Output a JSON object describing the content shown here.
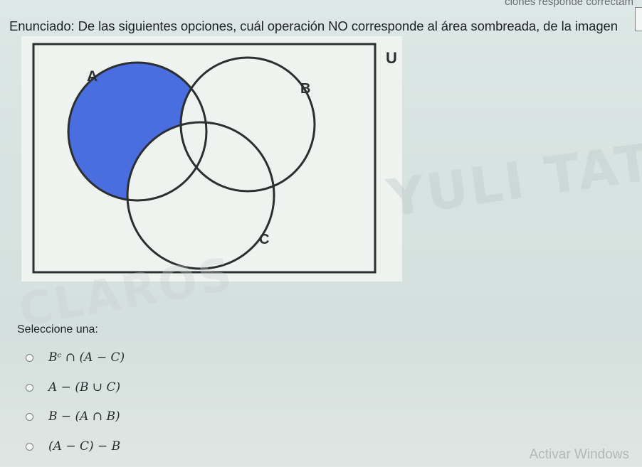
{
  "header": {
    "fragment": "ciones responde correctam"
  },
  "question": {
    "statement": "Enunciado: De las siguientes opciones, cuál operación NO corresponde al área sombreada, de la imagen"
  },
  "venn": {
    "universe_label": "U",
    "set_labels": {
      "a": "A",
      "b": "B",
      "c": "C"
    },
    "shaded_region": "A − (B ∪ C)",
    "colors": {
      "shade": "#4a6ee0",
      "outline": "#2c2f31",
      "background": "#eff3f0"
    }
  },
  "answers": {
    "prompt": "Seleccione una:",
    "options": [
      {
        "label": "Bᶜ ∩ (A − C)"
      },
      {
        "label": "A − (B ∪ C)"
      },
      {
        "label": "B − (A ∩ B)"
      },
      {
        "label": "(A − C) − B"
      }
    ]
  },
  "watermark": {
    "line1": "YULI TATIANA GIRALDO",
    "line2": "CLAROS"
  },
  "system": {
    "activate_windows": "Activar Windows"
  }
}
